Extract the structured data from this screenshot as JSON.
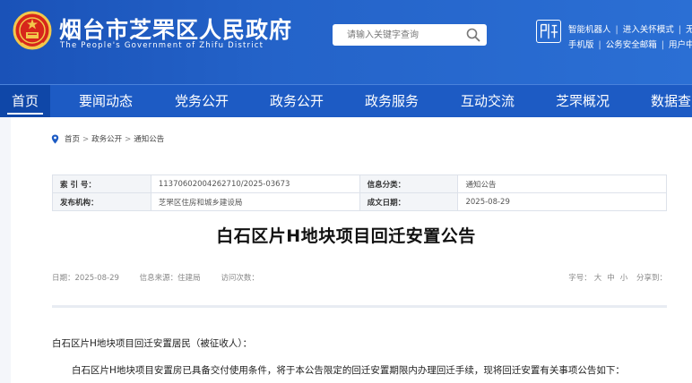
{
  "header": {
    "site_title": "烟台市芝罘区人民政府",
    "site_subtitle": "The People's Government of Zhifu District",
    "search_placeholder": "请输入关键字查询",
    "quick_links_row1": [
      "智能机器人",
      "进入关怀模式",
      "无障"
    ],
    "quick_links_row2": [
      "手机版",
      "公务安全邮箱",
      "用户中"
    ],
    "brand_color": "#1d5bc4"
  },
  "nav": {
    "items": [
      "首页",
      "要闻动态",
      "党务公开",
      "政务公开",
      "政务服务",
      "互动交流",
      "芝罘概况",
      "数据查"
    ]
  },
  "breadcrumb": {
    "items": [
      "首页",
      "政务公开",
      "通知公告"
    ],
    "separator": ">"
  },
  "meta": {
    "index_label": "索 引 号：",
    "index_value": "11370602004262710/2025-03673",
    "category_label": "信息分类：",
    "category_value": "通知公告",
    "publisher_label": "发布机构：",
    "publisher_value": "芝罘区住房和城乡建设局",
    "date_label": "成文日期：",
    "date_value": "2025-08-29"
  },
  "article": {
    "title": "白石区片H地块项目回迁安置公告",
    "date": "日期：2025-08-29",
    "source": "信息来源：住建局",
    "visits": "访问次数：",
    "font_size_label": "字号：",
    "font_size_options": [
      "大",
      "中",
      "小"
    ],
    "share_label": "分享到：",
    "para1": "白石区片H地块项目回迁安置居民（被征收人）：",
    "para2": "白石区片H地块项目安置房已具备交付使用条件，将于本公告限定的回迁安置期限内办理回迁手续，现将回迁安置有关事项公告如下："
  }
}
